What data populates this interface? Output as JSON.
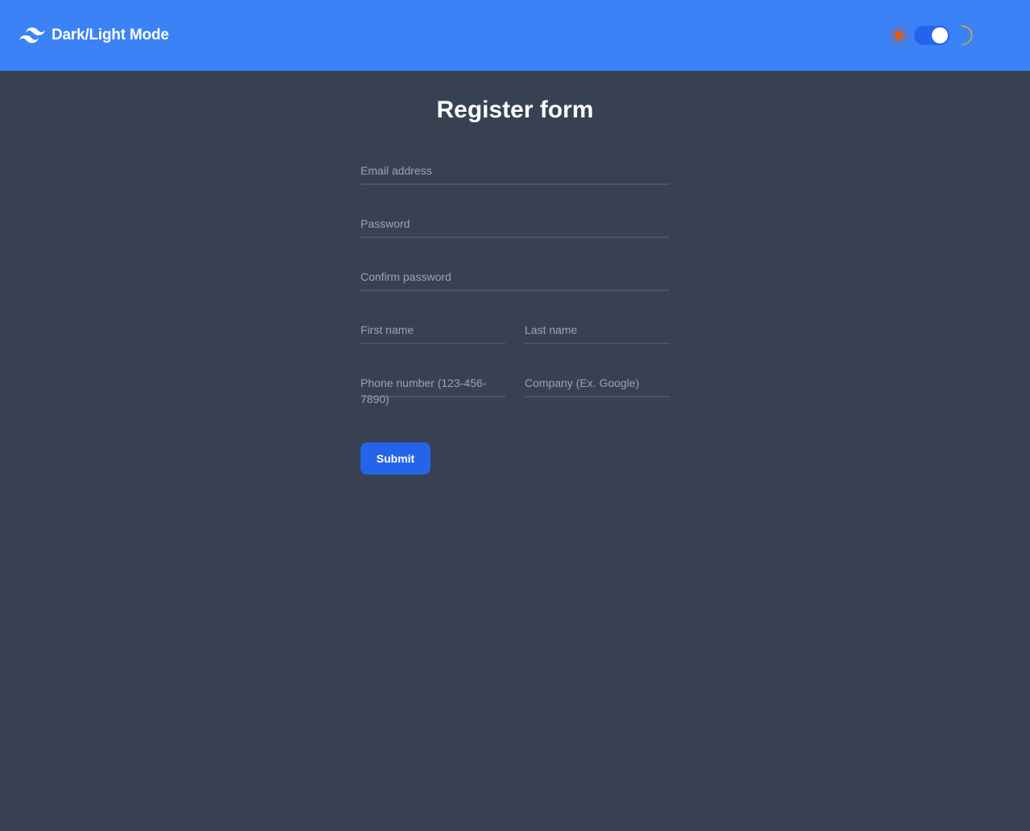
{
  "navbar": {
    "title": "Dark/Light Mode",
    "logo_icon": "tailwind-wave-logo",
    "theme_toggle": {
      "state": "dark",
      "sun_icon": "sun-icon",
      "moon_icon": "moon-icon"
    }
  },
  "form": {
    "title": "Register form",
    "fields": {
      "email": {
        "label": "Email address",
        "value": ""
      },
      "password": {
        "label": "Password",
        "value": ""
      },
      "confirm_password": {
        "label": "Confirm password",
        "value": ""
      },
      "first_name": {
        "label": "First name",
        "value": ""
      },
      "last_name": {
        "label": "Last name",
        "value": ""
      },
      "phone": {
        "label": "Phone number (123-456-7890)",
        "value": ""
      },
      "company": {
        "label": "Company (Ex. Google)",
        "value": ""
      }
    },
    "submit_label": "Submit"
  },
  "colors": {
    "navbar_bg": "#3b82f6",
    "page_bg": "#374151",
    "button_bg": "#2563eb",
    "sun": "#ea580c",
    "moon": "#eab308"
  }
}
